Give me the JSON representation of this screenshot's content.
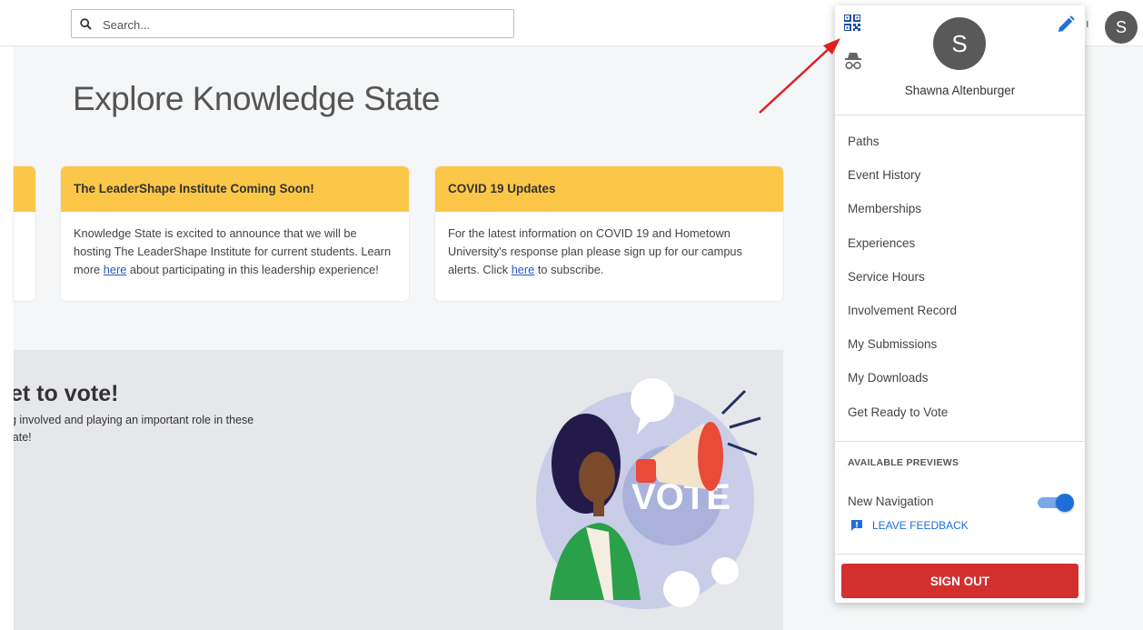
{
  "search": {
    "placeholder": "Search..."
  },
  "topbar": {
    "partial_letter": "ı",
    "avatar_initial": "S"
  },
  "main": {
    "title": "Explore Knowledge State",
    "cards": [
      {
        "title": "The LeaderShape Institute Coming Soon!",
        "text_before": "Knowledge State is excited to announce that we will be hosting The LeaderShape Institute for current students.  Learn more ",
        "link": "here",
        "text_after": " about participating in this leadership experience!"
      },
      {
        "title": "COVID 19 Updates",
        "text_before": "For the latest information on COVID 19 and Hometown University's response plan please sign up for our campus alerts. Click ",
        "link": "here",
        "text_after": " to subscribe."
      }
    ],
    "banner": {
      "title": "et to vote!",
      "line1": "g involved and playing an important role in these",
      "line2": "late!",
      "illustration_text": "VOTE"
    }
  },
  "dropdown": {
    "avatar_initial": "S",
    "user_name": "Shawna Altenburger",
    "menu": [
      "Paths",
      "Event History",
      "Memberships",
      "Experiences",
      "Service Hours",
      "Involvement Record",
      "My Submissions",
      "My Downloads",
      "Get Ready to Vote"
    ],
    "previews_label": "AVAILABLE PREVIEWS",
    "new_navigation_label": "New Navigation",
    "new_navigation_enabled": true,
    "feedback_label": "LEAVE FEEDBACK",
    "signout_label": "SIGN OUT",
    "icons": [
      "qr-code-icon",
      "incognito-icon",
      "edit-pencil-icon",
      "feedback-icon"
    ]
  },
  "colors": {
    "card_header": "#fcc748",
    "accent_blue": "#1e6fd9",
    "signout_red": "#d32f2f",
    "annotation_arrow": "#e02020"
  }
}
